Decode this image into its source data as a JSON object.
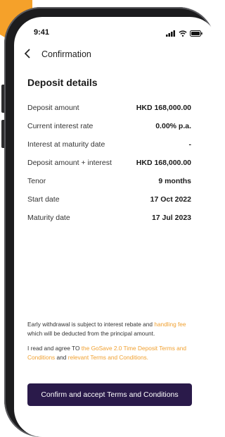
{
  "status_bar": {
    "time": "9:41",
    "icons": [
      "signal-icon",
      "wifi-icon",
      "battery-icon"
    ]
  },
  "nav": {
    "back_icon": "chevron-left-icon",
    "title": "Confirmation"
  },
  "deposit_details": {
    "title": "Deposit details",
    "rows": [
      {
        "label": "Deposit amount",
        "value": "HKD 168,000.00"
      },
      {
        "label": "Current interest rate",
        "value": "0.00% p.a."
      },
      {
        "label": "Interest at maturity date",
        "value": "-"
      },
      {
        "label": "Deposit amount + interest",
        "value": "HKD 168,000.00"
      },
      {
        "label": "Tenor",
        "value": "9 months"
      },
      {
        "label": "Start date",
        "value": "17 Oct 2022"
      },
      {
        "label": "Maturity date",
        "value": "17 Jul 2023"
      }
    ]
  },
  "notice": {
    "early_withdrawal_before": "Early withdrawal is subject to interest rebate and ",
    "handling_fee_link": "handling fee",
    "early_withdrawal_after": " which will be deducted from the principal amount.",
    "agree_before": "I read and agree TO ",
    "terms_link_1": "the GoSave 2.0 Time Deposit Terms and Conditions",
    "agree_middle": " and ",
    "terms_link_2": "relevant Terms and Conditions."
  },
  "confirm_button": {
    "label": "Confirm and accept Terms and Conditions"
  },
  "colors": {
    "accent": "#f5a12a",
    "link": "#f0a030",
    "button_bg": "#2a1a4a",
    "frame": "#1c1c1e"
  }
}
